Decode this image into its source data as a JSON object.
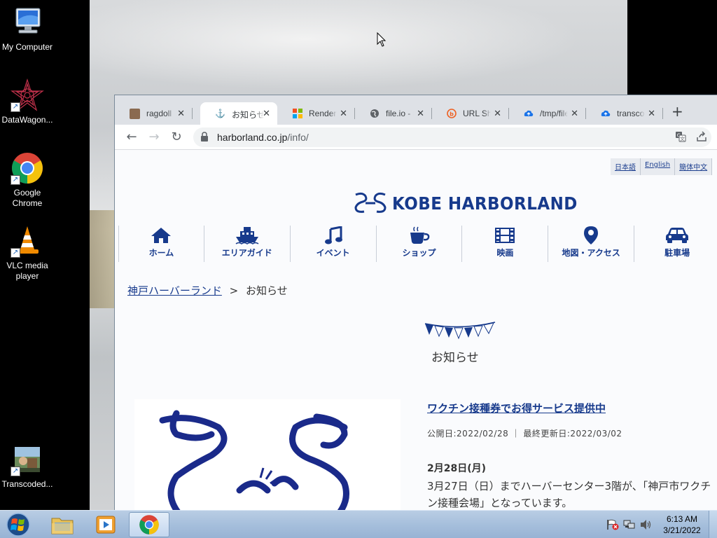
{
  "desktop": {
    "icons": [
      {
        "label": "My Computer"
      },
      {
        "label": "DataWagon..."
      },
      {
        "label": "Google Chrome"
      },
      {
        "label": "VLC media player"
      },
      {
        "label": "Transcoded..."
      }
    ]
  },
  "browser": {
    "tabs": [
      {
        "title": "ragdoll g",
        "favicon": "cat-photo-icon",
        "active": false
      },
      {
        "title": "お知らせ",
        "favicon": "harborland-icon",
        "active": true
      },
      {
        "title": "Renderi",
        "favicon": "windows-logo-icon",
        "active": false
      },
      {
        "title": "file.io - S",
        "favicon": "globe-icon",
        "active": false
      },
      {
        "title": "URL Sho",
        "favicon": "bitly-icon",
        "active": false
      },
      {
        "title": "/tmp/file",
        "favicon": "cloud-upload-icon",
        "active": false
      },
      {
        "title": "transcod",
        "favicon": "cloud-upload-icon",
        "active": false
      }
    ],
    "url_domain": "harborland.co.jp",
    "url_path": "/info/"
  },
  "page": {
    "languages": [
      "日本語",
      "English",
      "簡体中文"
    ],
    "logo_text": "KOBE HARBORLAND",
    "nav": [
      {
        "label": "ホーム",
        "icon": "home-icon"
      },
      {
        "label": "エリアガイド",
        "icon": "ship-icon"
      },
      {
        "label": "イベント",
        "icon": "music-note-icon"
      },
      {
        "label": "ショップ",
        "icon": "coffee-cup-icon"
      },
      {
        "label": "映画",
        "icon": "film-icon"
      },
      {
        "label": "地図・アクセス",
        "icon": "map-pin-icon"
      },
      {
        "label": "駐車場",
        "icon": "car-icon"
      }
    ],
    "breadcrumb": {
      "home": "神戸ハーバーランド",
      "sep": ">",
      "current": "お知らせ"
    },
    "section_title": "お知らせ",
    "article": {
      "title": "ワクチン接種券でお得サービス提供中",
      "meta": "公開日:2022/02/28 ｜ 最終更新日:2022/03/02",
      "date_heading": "2月28日(月)",
      "body_line1": "3月27日（日）までハーバーセンター3階が、「神戸市ワクチ",
      "body_line2": "ン接種会場」となっています。"
    }
  },
  "taskbar": {
    "time": "6:13 AM",
    "date": "3/21/2022"
  },
  "colors": {
    "brand": "#173a8c",
    "tabstrip": "#dee1e6",
    "taskbar": "#a6bfdc"
  }
}
